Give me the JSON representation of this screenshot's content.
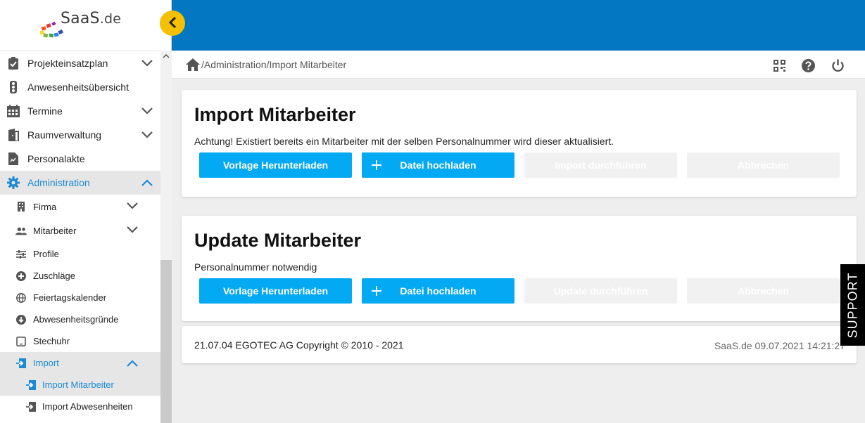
{
  "logo": {
    "name": "SaaS",
    "suffix": ".de"
  },
  "breadcrumb": {
    "path": "/Administration/Import Mitarbeiter"
  },
  "nav": {
    "items": [
      {
        "label": "Projekteinsatzplan",
        "icon": "clipboard-check-icon"
      },
      {
        "label": "Anwesenheitsübersicht",
        "icon": "traffic-light-icon"
      },
      {
        "label": "Termine",
        "icon": "calendar-icon"
      },
      {
        "label": "Raumverwaltung",
        "icon": "door-icon"
      },
      {
        "label": "Personalakte",
        "icon": "file-icon"
      },
      {
        "label": "Administration",
        "icon": "gear-icon"
      }
    ],
    "admin_sub": [
      {
        "label": "Firma",
        "icon": "building-icon"
      },
      {
        "label": "Mitarbeiter",
        "icon": "people-icon"
      },
      {
        "label": "Profile",
        "icon": "sliders-icon"
      },
      {
        "label": "Zuschläge",
        "icon": "plus-circle-icon"
      },
      {
        "label": "Feiertagskalender",
        "icon": "globe-icon"
      },
      {
        "label": "Abwesenheitsgründe",
        "icon": "arrow-down-circle-icon"
      },
      {
        "label": "Stechuhr",
        "icon": "tablet-icon"
      },
      {
        "label": "Import",
        "icon": "import-icon"
      }
    ],
    "import_sub": [
      {
        "label": "Import Mitarbeiter",
        "icon": "import-icon"
      },
      {
        "label": "Import Abwesenheiten",
        "icon": "import-icon"
      }
    ]
  },
  "import_card": {
    "title": "Import Mitarbeiter",
    "note": "Achtung! Existiert bereits ein Mitarbeiter mit der selben Personalnummer wird dieser aktualisiert.",
    "btn_template": "Vorlage Herunterladen",
    "btn_upload": "Datei hochladen",
    "btn_run": "Import durchführen",
    "btn_cancel": "Abbrechen"
  },
  "update_card": {
    "title": "Update Mitarbeiter",
    "note": "Personalnummer notwendig",
    "btn_template": "Vorlage Herunterladen",
    "btn_upload": "Datei hochladen",
    "btn_run": "Update durchführen",
    "btn_cancel": "Abbrechen"
  },
  "footer": {
    "copyright": "21.07.04 EGOTEC AG Copyright © 2010 - 2021",
    "right": "SaaS.de  09.07.2021 14:21:27"
  },
  "support": {
    "label": "SUPPORT"
  },
  "colors": {
    "topbar": "#0377c2",
    "accent": "#04a9f4",
    "active_text": "#1e8ad6",
    "collapse": "#f5c000"
  }
}
